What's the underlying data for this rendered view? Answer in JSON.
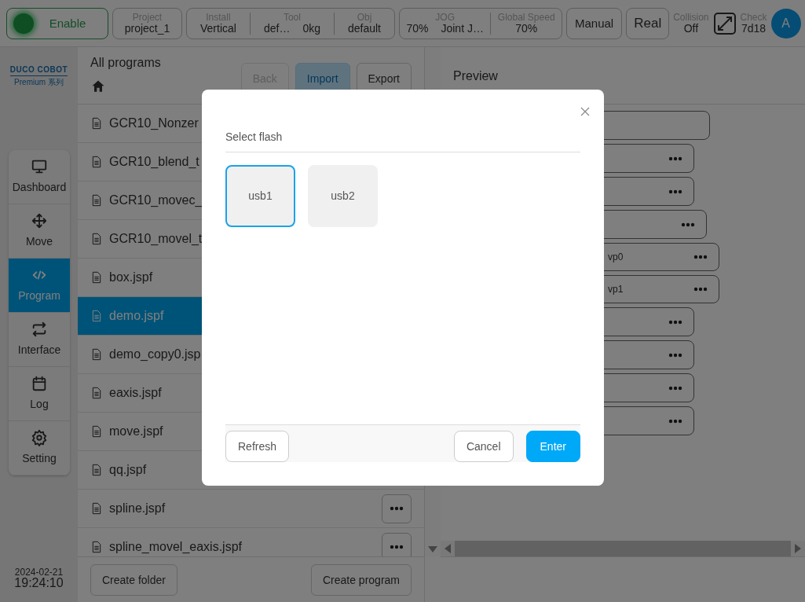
{
  "top_bar": {
    "enable": {
      "label": "Enable",
      "on": true
    },
    "groups": [
      {
        "fields": [
          {
            "label": "Project",
            "values": [
              "project_1"
            ]
          }
        ]
      },
      {
        "fields": [
          {
            "label": "Install",
            "values": [
              "Vertical"
            ]
          },
          {
            "label": "Tool",
            "values": [
              "def…",
              "0kg"
            ]
          },
          {
            "label": "Obj",
            "values": [
              "default"
            ]
          }
        ]
      },
      {
        "fields": [
          {
            "label": "JOG",
            "values": [
              "70%",
              "Joint J…"
            ]
          },
          {
            "label": "Global Speed",
            "values": [
              "70%"
            ]
          }
        ]
      }
    ],
    "mode_button": "Manual",
    "real_button": "Real",
    "collision": {
      "label": "Collision",
      "value": "Off"
    },
    "check": {
      "label": "Check",
      "value": "7d18"
    },
    "avatar": "A"
  },
  "sidebar": {
    "logo": {
      "brand": "DUCO COBOT",
      "sub": "Premium 系列"
    },
    "items": [
      {
        "kind": "monitor",
        "label": "Dashboard",
        "selected": false
      },
      {
        "kind": "move",
        "label": "Move",
        "selected": false
      },
      {
        "kind": "code",
        "label": "Program",
        "selected": true
      },
      {
        "kind": "swap",
        "label": "Interface",
        "selected": false
      },
      {
        "kind": "calendar",
        "label": "Log",
        "selected": false
      },
      {
        "kind": "gear",
        "label": "Setting",
        "selected": false
      }
    ],
    "date": "2024-02-21",
    "time": "19:24:10"
  },
  "programs": {
    "title": "All programs",
    "buttons": [
      {
        "label": "Back",
        "disabled": true,
        "selected": false
      },
      {
        "label": "Import",
        "disabled": false,
        "selected": true
      },
      {
        "label": "Export",
        "disabled": false,
        "selected": false
      }
    ],
    "files": [
      {
        "name": "GCR10_Nonzer",
        "selected": false
      },
      {
        "name": "GCR10_blend_t",
        "selected": false
      },
      {
        "name": "GCR10_movec_",
        "selected": false
      },
      {
        "name": "GCR10_movel_t",
        "selected": false
      },
      {
        "name": "box.jspf",
        "selected": false
      },
      {
        "name": "demo.jspf",
        "selected": true
      },
      {
        "name": "demo_copy0.jsp",
        "selected": false
      },
      {
        "name": "eaxis.jspf",
        "selected": false
      },
      {
        "name": "move.jspf",
        "selected": false
      },
      {
        "name": "qq.jspf",
        "selected": false
      },
      {
        "name": "spline.jspf",
        "selected": false,
        "more": true
      },
      {
        "name": "spline_movel_eaxis.jspf",
        "selected": false,
        "more": true
      }
    ],
    "footer_buttons": [
      "Create folder",
      "Create program"
    ]
  },
  "preview": {
    "title": "Preview",
    "blocks": [
      {
        "kind": "plain"
      },
      {
        "kind": "menu"
      },
      {
        "kind": "menu"
      },
      {
        "kind": "menu"
      },
      {
        "text": "vp0",
        "kind": "menu"
      },
      {
        "text": "vp1",
        "kind": "menu"
      },
      {
        "kind": "menu"
      },
      {
        "kind": "menu"
      },
      {
        "kind": "menu"
      },
      {
        "kind": "menu"
      }
    ]
  },
  "dialog": {
    "title": "Select flash",
    "devices": [
      {
        "label": "usb1",
        "selected": true
      },
      {
        "label": "usb2",
        "selected": false
      }
    ],
    "refresh": "Refresh",
    "cancel": "Cancel",
    "enter": "Enter"
  }
}
